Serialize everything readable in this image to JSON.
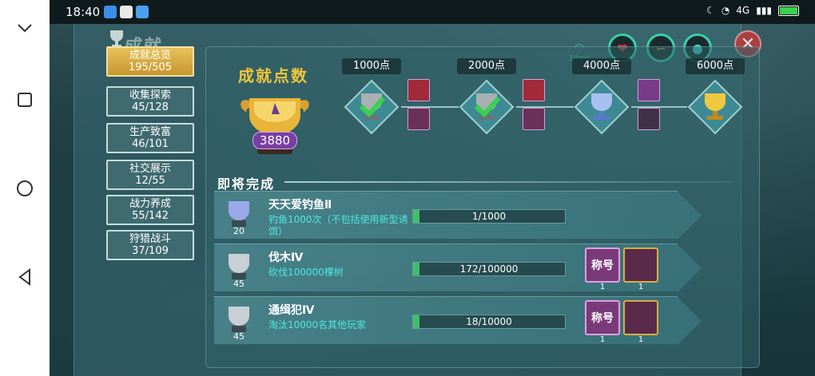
{
  "status_bar": {
    "time": "18:40",
    "network": "4G",
    "battery": "99"
  },
  "title": "成就",
  "hud": {
    "signal_text": "34ms",
    "buttons": [
      "heart",
      "swirl",
      "drop"
    ]
  },
  "sidebar": {
    "items": [
      {
        "label": "成就总览",
        "count": "195/505",
        "active": true
      },
      {
        "label": "收集探索",
        "count": "45/128",
        "active": false
      },
      {
        "label": "生产致富",
        "count": "46/101",
        "active": false
      },
      {
        "label": "社交展示",
        "count": "12/55",
        "active": false
      },
      {
        "label": "战力养成",
        "count": "55/142",
        "active": false
      },
      {
        "label": "狩猎战斗",
        "count": "37/109",
        "active": false
      }
    ]
  },
  "summary": {
    "title": "成就点数",
    "points": "3880",
    "milestones": [
      {
        "label": "1000点",
        "tier": "silver",
        "claimed": true,
        "rewards": [
          "red",
          "none"
        ]
      },
      {
        "label": "2000点",
        "tier": "silver",
        "claimed": true,
        "rewards": [
          "red",
          "frame"
        ]
      },
      {
        "label": "4000点",
        "tier": "blue",
        "claimed": false,
        "rewards": [
          "purple",
          "dark"
        ]
      },
      {
        "label": "6000点",
        "tier": "gold",
        "claimed": false,
        "rewards": []
      }
    ]
  },
  "upcoming": {
    "title": "即将完成",
    "rows": [
      {
        "name": "天天爱钓鱼Ⅱ",
        "desc": "钓鱼1000次（不包括使用新型诱饵）",
        "progress_text": "1/1000",
        "progress": 0.001,
        "level": "20",
        "rewards": []
      },
      {
        "name": "伐木Ⅳ",
        "desc": "砍伐100000棵树",
        "progress_text": "172/100000",
        "progress": 0.0017,
        "level": "45",
        "rewards": [
          {
            "label": "称号",
            "count": "1"
          },
          {
            "label": "",
            "count": "1"
          }
        ]
      },
      {
        "name": "通缉犯Ⅳ",
        "desc": "淘汰10000名其他玩家",
        "progress_text": "18/10000",
        "progress": 0.0018,
        "level": "45",
        "rewards": [
          {
            "label": "称号",
            "count": "1"
          },
          {
            "label": "",
            "count": "1"
          }
        ]
      }
    ]
  },
  "colors": {
    "accent_gold": "#f0c53a",
    "progress_green": "#3fc06a",
    "desc_cyan": "#4de8e0"
  }
}
